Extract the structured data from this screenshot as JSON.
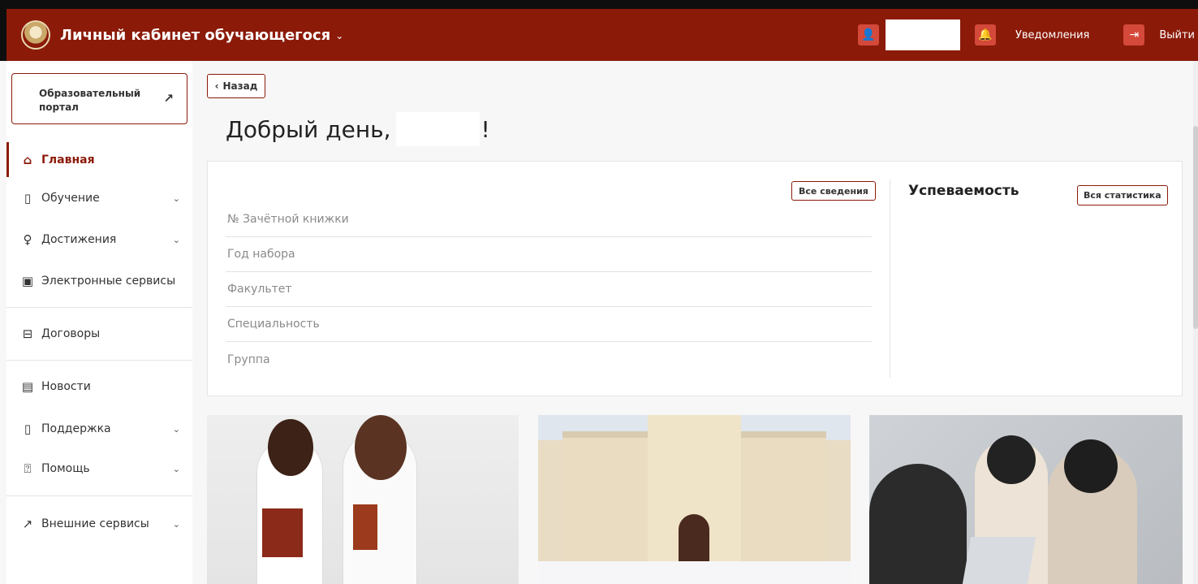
{
  "header": {
    "title": "Личный кабинет обучающегося",
    "notifications_label": "Уведомления",
    "exit_label": "Выйти",
    "color": "#8b1a09"
  },
  "sidebar": {
    "portal_label": "Образовательный портал",
    "items": [
      {
        "label": "Главная",
        "icon": "home-icon",
        "active": true
      },
      {
        "label": "Обучение",
        "icon": "book-icon",
        "expandable": true
      },
      {
        "label": "Достижения",
        "icon": "award-icon",
        "expandable": true
      },
      {
        "label": "Электронные сервисы",
        "icon": "services-icon"
      },
      {
        "label": "Договоры",
        "icon": "briefcase-icon"
      },
      {
        "label": "Новости",
        "icon": "newspaper-icon"
      },
      {
        "label": "Поддержка",
        "icon": "book-icon",
        "expandable": true
      },
      {
        "label": "Помощь",
        "icon": "question-icon",
        "expandable": true
      },
      {
        "label": "Внешние сервисы",
        "icon": "external-link-icon",
        "expandable": true
      }
    ]
  },
  "main": {
    "back_label": "Назад",
    "greeting": "Добрый день,",
    "greeting_end": "!",
    "info": {
      "all_info_label": "Все сведения",
      "rows": [
        "№ Зачётной книжки",
        "Год набора",
        "Факультет",
        "Специальность",
        "Группа"
      ]
    },
    "performance": {
      "title": "Успеваемость",
      "all_stats_label": "Вся статистика"
    }
  }
}
